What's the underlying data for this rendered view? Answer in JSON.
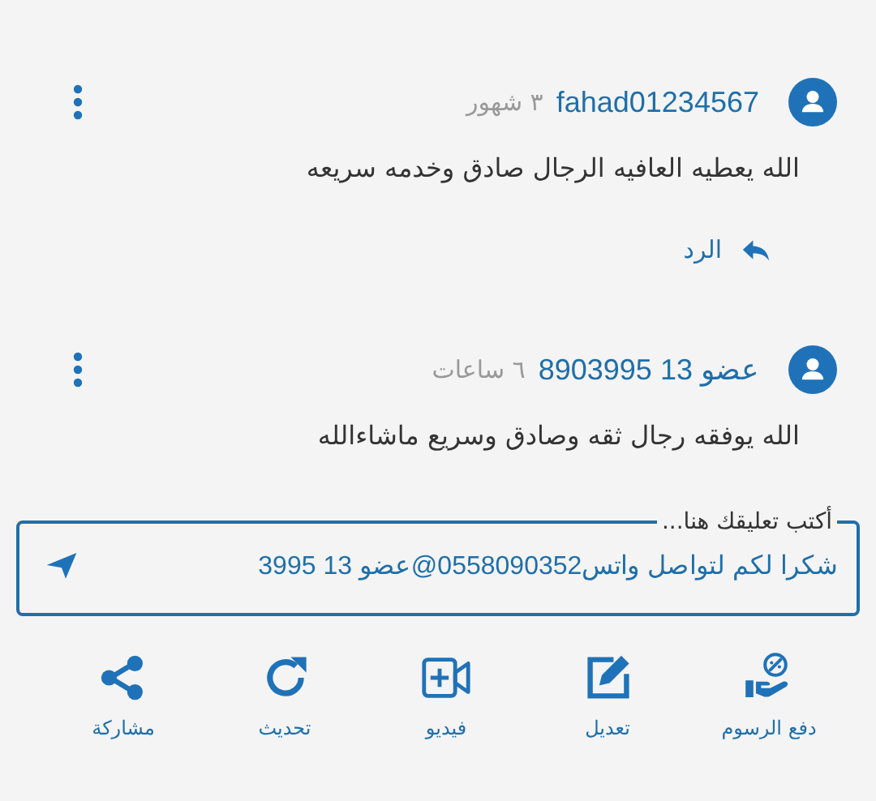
{
  "comments": [
    {
      "user": "fahad01234567",
      "time": "٣ شهور",
      "text": "الله يعطيه العافيه الرجال صادق وخدمه سريعه",
      "reply": "الرد"
    },
    {
      "user": "عضو 13 8903995",
      "time": "٦ ساعات",
      "text": "الله يوفقه رجال ثقه وصادق وسريع ماشاءالله"
    }
  ],
  "comment_field": {
    "placeholder": "أكتب تعليقك هنا...",
    "value": "شكرا لكم لتواصل واتس0558090352@عضو 13 3995"
  },
  "actions": [
    {
      "kind": "fees",
      "label": "دفع الرسوم"
    },
    {
      "kind": "edit",
      "label": "تعديل"
    },
    {
      "kind": "video",
      "label": "فيديو"
    },
    {
      "kind": "refresh",
      "label": "تحديث"
    },
    {
      "kind": "share",
      "label": "مشاركة"
    }
  ]
}
